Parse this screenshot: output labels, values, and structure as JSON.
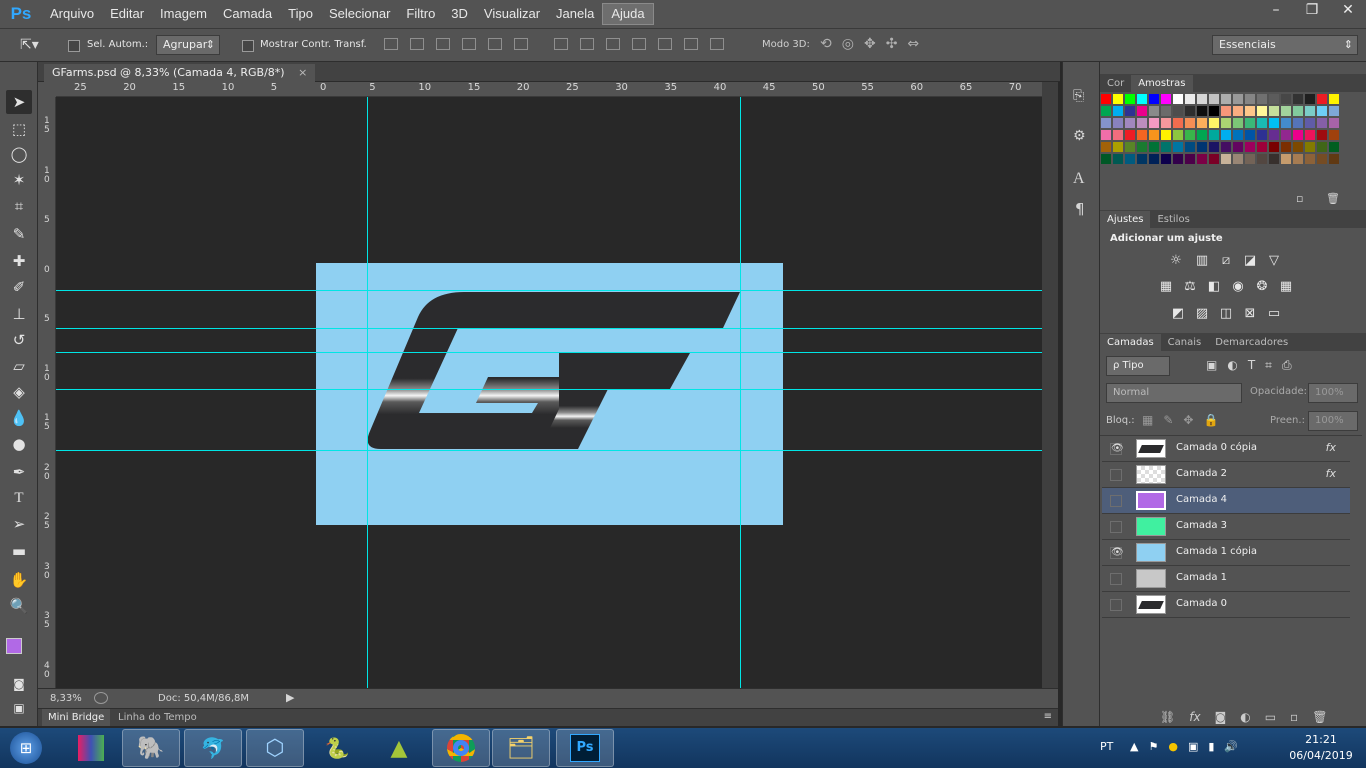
{
  "app": {
    "logo": "Ps"
  },
  "menu": [
    "Arquivo",
    "Editar",
    "Imagem",
    "Camada",
    "Tipo",
    "Selecionar",
    "Filtro",
    "3D",
    "Visualizar",
    "Janela",
    "Ajuda"
  ],
  "window_controls": {
    "minimize": "–",
    "restore": "❐",
    "close": "✕"
  },
  "options": {
    "auto_select_label": "Sel. Autom.:",
    "auto_select_value": "Agrupar",
    "show_transform_label": "Mostrar Contr. Transf.",
    "mode3d_label": "Modo 3D:",
    "workspace": "Essenciais"
  },
  "document": {
    "tab_title": "GFarms.psd @ 8,33% (Camada 4, RGB/8*)",
    "close": "×"
  },
  "ruler": {
    "h_labels": [
      "25",
      "20",
      "15",
      "10",
      "5",
      "0",
      "5",
      "10",
      "15",
      "20",
      "25",
      "30",
      "35",
      "40",
      "45",
      "50",
      "55",
      "60",
      "65",
      "70"
    ],
    "v_labels": [
      "15",
      "10",
      "5",
      "0",
      "5",
      "10",
      "15",
      "20",
      "25",
      "30",
      "35",
      "40"
    ]
  },
  "status": {
    "zoom": "8,33%",
    "doc": "Doc: 50,4M/86,8M"
  },
  "bottom_tabs": [
    "Mini Bridge",
    "Linha do Tempo"
  ],
  "panels": {
    "color_tabs": [
      "Cor",
      "Amostras"
    ],
    "adjust_tabs": [
      "Ajustes",
      "Estilos"
    ],
    "adjust_title": "Adicionar um ajuste",
    "layer_tabs": [
      "Camadas",
      "Canais",
      "Demarcadores"
    ],
    "filter_kind": "ρ Tipo",
    "blend_mode": "Normal",
    "opacity_label": "Opacidade:",
    "opacity_value": "100%",
    "lock_label": "Bloq.:",
    "fill_label": "Preen.:",
    "fill_value": "100%"
  },
  "layers": [
    {
      "name": "Camada 0 cópia",
      "visible": true,
      "fx": "fx",
      "thumb": "logo"
    },
    {
      "name": "Camada 2",
      "visible": false,
      "fx": "fx",
      "thumb": "checker"
    },
    {
      "name": "Camada 4",
      "visible": false,
      "fx": "",
      "thumb": "#b169e6",
      "selected": true
    },
    {
      "name": "Camada 3",
      "visible": false,
      "fx": "",
      "thumb": "#40f0a0"
    },
    {
      "name": "Camada 1 cópia",
      "visible": true,
      "fx": "",
      "thumb": "#8fd0f2"
    },
    {
      "name": "Camada 1",
      "visible": false,
      "fx": "",
      "thumb": "#c8c8c8"
    },
    {
      "name": "Camada 0",
      "visible": false,
      "fx": "",
      "thumb": "logo"
    }
  ],
  "colors": {
    "foreground": "#b169e6",
    "background": "#ffffff",
    "canvas_bg": "#8fd0f2",
    "guide": "#00e5e5",
    "logo": "#2b2b2d"
  },
  "taskbar": {
    "lang": "PT",
    "time": "21:21",
    "date": "06/04/2019"
  }
}
